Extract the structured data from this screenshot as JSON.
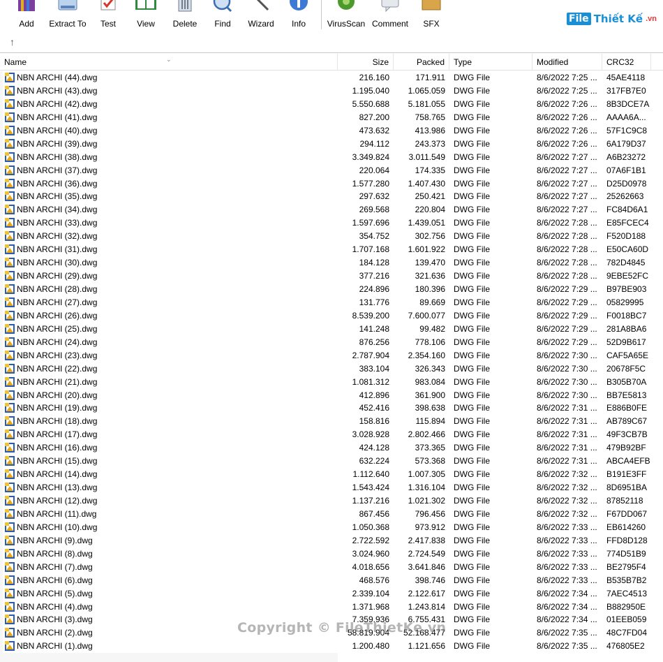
{
  "toolbar": {
    "buttons": [
      {
        "label": "Add",
        "icon": "add-archive-icon"
      },
      {
        "label": "Extract To",
        "icon": "extract-icon"
      },
      {
        "label": "Test",
        "icon": "test-icon"
      },
      {
        "label": "View",
        "icon": "view-book-icon"
      },
      {
        "label": "Delete",
        "icon": "delete-bin-icon"
      },
      {
        "label": "Find",
        "icon": "find-magnifier-icon"
      },
      {
        "label": "Wizard",
        "icon": "wizard-wand-icon"
      },
      {
        "label": "Info",
        "icon": "info-icon"
      },
      {
        "label": "VirusScan",
        "icon": "virus-scan-icon"
      },
      {
        "label": "Comment",
        "icon": "comment-icon"
      },
      {
        "label": "SFX",
        "icon": "sfx-box-icon"
      }
    ]
  },
  "brand": {
    "logo": "File",
    "text": "Thiết Kế",
    "suffix": ".vn"
  },
  "nav": {
    "up_icon": "up-arrow-icon"
  },
  "columns": {
    "name": "Name",
    "size": "Size",
    "packed": "Packed",
    "type": "Type",
    "modified": "Modified",
    "crc": "CRC32"
  },
  "files": [
    {
      "name": "NBN ARCHI (44).dwg",
      "size": "216.160",
      "packed": "171.911",
      "type": "DWG File",
      "modified": "8/6/2022 7:25 ...",
      "crc": "45AE4118"
    },
    {
      "name": "NBN ARCHI (43).dwg",
      "size": "1.195.040",
      "packed": "1.065.059",
      "type": "DWG File",
      "modified": "8/6/2022 7:25 ...",
      "crc": "317FB7E0"
    },
    {
      "name": "NBN ARCHI (42).dwg",
      "size": "5.550.688",
      "packed": "5.181.055",
      "type": "DWG File",
      "modified": "8/6/2022 7:26 ...",
      "crc": "8B3DCE7A"
    },
    {
      "name": "NBN ARCHI (41).dwg",
      "size": "827.200",
      "packed": "758.765",
      "type": "DWG File",
      "modified": "8/6/2022 7:26 ...",
      "crc": "AAAA6A..."
    },
    {
      "name": "NBN ARCHI (40).dwg",
      "size": "473.632",
      "packed": "413.986",
      "type": "DWG File",
      "modified": "8/6/2022 7:26 ...",
      "crc": "57F1C9C8"
    },
    {
      "name": "NBN ARCHI (39).dwg",
      "size": "294.112",
      "packed": "243.373",
      "type": "DWG File",
      "modified": "8/6/2022 7:26 ...",
      "crc": "6A179D37"
    },
    {
      "name": "NBN ARCHI (38).dwg",
      "size": "3.349.824",
      "packed": "3.011.549",
      "type": "DWG File",
      "modified": "8/6/2022 7:27 ...",
      "crc": "A6B23272"
    },
    {
      "name": "NBN ARCHI (37).dwg",
      "size": "220.064",
      "packed": "174.335",
      "type": "DWG File",
      "modified": "8/6/2022 7:27 ...",
      "crc": "07A6F1B1"
    },
    {
      "name": "NBN ARCHI (36).dwg",
      "size": "1.577.280",
      "packed": "1.407.430",
      "type": "DWG File",
      "modified": "8/6/2022 7:27 ...",
      "crc": "D25D0978"
    },
    {
      "name": "NBN ARCHI (35).dwg",
      "size": "297.632",
      "packed": "250.421",
      "type": "DWG File",
      "modified": "8/6/2022 7:27 ...",
      "crc": "25262663"
    },
    {
      "name": "NBN ARCHI (34).dwg",
      "size": "269.568",
      "packed": "220.804",
      "type": "DWG File",
      "modified": "8/6/2022 7:27 ...",
      "crc": "FC84D6A1"
    },
    {
      "name": "NBN ARCHI (33).dwg",
      "size": "1.597.696",
      "packed": "1.439.051",
      "type": "DWG File",
      "modified": "8/6/2022 7:28 ...",
      "crc": "E85FCEC4"
    },
    {
      "name": "NBN ARCHI (32).dwg",
      "size": "354.752",
      "packed": "302.756",
      "type": "DWG File",
      "modified": "8/6/2022 7:28 ...",
      "crc": "F520D188"
    },
    {
      "name": "NBN ARCHI (31).dwg",
      "size": "1.707.168",
      "packed": "1.601.922",
      "type": "DWG File",
      "modified": "8/6/2022 7:28 ...",
      "crc": "E50CA60D"
    },
    {
      "name": "NBN ARCHI (30).dwg",
      "size": "184.128",
      "packed": "139.470",
      "type": "DWG File",
      "modified": "8/6/2022 7:28 ...",
      "crc": "782D4845"
    },
    {
      "name": "NBN ARCHI (29).dwg",
      "size": "377.216",
      "packed": "321.636",
      "type": "DWG File",
      "modified": "8/6/2022 7:28 ...",
      "crc": "9EBE52FC"
    },
    {
      "name": "NBN ARCHI (28).dwg",
      "size": "224.896",
      "packed": "180.396",
      "type": "DWG File",
      "modified": "8/6/2022 7:29 ...",
      "crc": "B97BE903"
    },
    {
      "name": "NBN ARCHI (27).dwg",
      "size": "131.776",
      "packed": "89.669",
      "type": "DWG File",
      "modified": "8/6/2022 7:29 ...",
      "crc": "05829995"
    },
    {
      "name": "NBN ARCHI (26).dwg",
      "size": "8.539.200",
      "packed": "7.600.077",
      "type": "DWG File",
      "modified": "8/6/2022 7:29 ...",
      "crc": "F0018BC7"
    },
    {
      "name": "NBN ARCHI (25).dwg",
      "size": "141.248",
      "packed": "99.482",
      "type": "DWG File",
      "modified": "8/6/2022 7:29 ...",
      "crc": "281A8BA6"
    },
    {
      "name": "NBN ARCHI (24).dwg",
      "size": "876.256",
      "packed": "778.106",
      "type": "DWG File",
      "modified": "8/6/2022 7:29 ...",
      "crc": "52D9B617"
    },
    {
      "name": "NBN ARCHI (23).dwg",
      "size": "2.787.904",
      "packed": "2.354.160",
      "type": "DWG File",
      "modified": "8/6/2022 7:30 ...",
      "crc": "CAF5A65E"
    },
    {
      "name": "NBN ARCHI (22).dwg",
      "size": "383.104",
      "packed": "326.343",
      "type": "DWG File",
      "modified": "8/6/2022 7:30 ...",
      "crc": "20678F5C"
    },
    {
      "name": "NBN ARCHI (21).dwg",
      "size": "1.081.312",
      "packed": "983.084",
      "type": "DWG File",
      "modified": "8/6/2022 7:30 ...",
      "crc": "B305B70A"
    },
    {
      "name": "NBN ARCHI (20).dwg",
      "size": "412.896",
      "packed": "361.900",
      "type": "DWG File",
      "modified": "8/6/2022 7:30 ...",
      "crc": "BB7E5813"
    },
    {
      "name": "NBN ARCHI (19).dwg",
      "size": "452.416",
      "packed": "398.638",
      "type": "DWG File",
      "modified": "8/6/2022 7:31 ...",
      "crc": "E886B0FE"
    },
    {
      "name": "NBN ARCHI (18).dwg",
      "size": "158.816",
      "packed": "115.894",
      "type": "DWG File",
      "modified": "8/6/2022 7:31 ...",
      "crc": "AB789C67"
    },
    {
      "name": "NBN ARCHI (17).dwg",
      "size": "3.028.928",
      "packed": "2.802.466",
      "type": "DWG File",
      "modified": "8/6/2022 7:31 ...",
      "crc": "49F3CB7B"
    },
    {
      "name": "NBN ARCHI (16).dwg",
      "size": "424.128",
      "packed": "373.365",
      "type": "DWG File",
      "modified": "8/6/2022 7:31 ...",
      "crc": "479B92BF"
    },
    {
      "name": "NBN ARCHI (15).dwg",
      "size": "632.224",
      "packed": "573.368",
      "type": "DWG File",
      "modified": "8/6/2022 7:31 ...",
      "crc": "ABCA4EFB"
    },
    {
      "name": "NBN ARCHI (14).dwg",
      "size": "1.112.640",
      "packed": "1.007.305",
      "type": "DWG File",
      "modified": "8/6/2022 7:32 ...",
      "crc": "B191E3FF"
    },
    {
      "name": "NBN ARCHI (13).dwg",
      "size": "1.543.424",
      "packed": "1.316.104",
      "type": "DWG File",
      "modified": "8/6/2022 7:32 ...",
      "crc": "8D6951BA"
    },
    {
      "name": "NBN ARCHI (12).dwg",
      "size": "1.137.216",
      "packed": "1.021.302",
      "type": "DWG File",
      "modified": "8/6/2022 7:32 ...",
      "crc": "87852118"
    },
    {
      "name": "NBN ARCHI (11).dwg",
      "size": "867.456",
      "packed": "796.456",
      "type": "DWG File",
      "modified": "8/6/2022 7:32 ...",
      "crc": "F67DD067"
    },
    {
      "name": "NBN ARCHI (10).dwg",
      "size": "1.050.368",
      "packed": "973.912",
      "type": "DWG File",
      "modified": "8/6/2022 7:33 ...",
      "crc": "EB614260"
    },
    {
      "name": "NBN ARCHI (9).dwg",
      "size": "2.722.592",
      "packed": "2.417.838",
      "type": "DWG File",
      "modified": "8/6/2022 7:33 ...",
      "crc": "FFD8D128"
    },
    {
      "name": "NBN ARCHI (8).dwg",
      "size": "3.024.960",
      "packed": "2.724.549",
      "type": "DWG File",
      "modified": "8/6/2022 7:33 ...",
      "crc": "774D51B9"
    },
    {
      "name": "NBN ARCHI (7).dwg",
      "size": "4.018.656",
      "packed": "3.641.846",
      "type": "DWG File",
      "modified": "8/6/2022 7:33 ...",
      "crc": "BE2795F4"
    },
    {
      "name": "NBN ARCHI (6).dwg",
      "size": "468.576",
      "packed": "398.746",
      "type": "DWG File",
      "modified": "8/6/2022 7:33 ...",
      "crc": "B535B7B2"
    },
    {
      "name": "NBN ARCHI (5).dwg",
      "size": "2.339.104",
      "packed": "2.122.617",
      "type": "DWG File",
      "modified": "8/6/2022 7:34 ...",
      "crc": "7AEC4513"
    },
    {
      "name": "NBN ARCHI (4).dwg",
      "size": "1.371.968",
      "packed": "1.243.814",
      "type": "DWG File",
      "modified": "8/6/2022 7:34 ...",
      "crc": "B882950E"
    },
    {
      "name": "NBN ARCHI (3).dwg",
      "size": "7.359.936",
      "packed": "6.755.431",
      "type": "DWG File",
      "modified": "8/6/2022 7:34 ...",
      "crc": "01EEB059"
    },
    {
      "name": "NBN ARCHI (2).dwg",
      "size": "58.819.904",
      "packed": "52.168.477",
      "type": "DWG File",
      "modified": "8/6/2022 7:35 ...",
      "crc": "48C7FD04"
    },
    {
      "name": "NBN ARCHI (1).dwg",
      "size": "1.200.480",
      "packed": "1.121.656",
      "type": "DWG File",
      "modified": "8/6/2022 7:35 ...",
      "crc": "476805E2"
    }
  ],
  "watermark": "Copyright © FileThietKe.vn"
}
